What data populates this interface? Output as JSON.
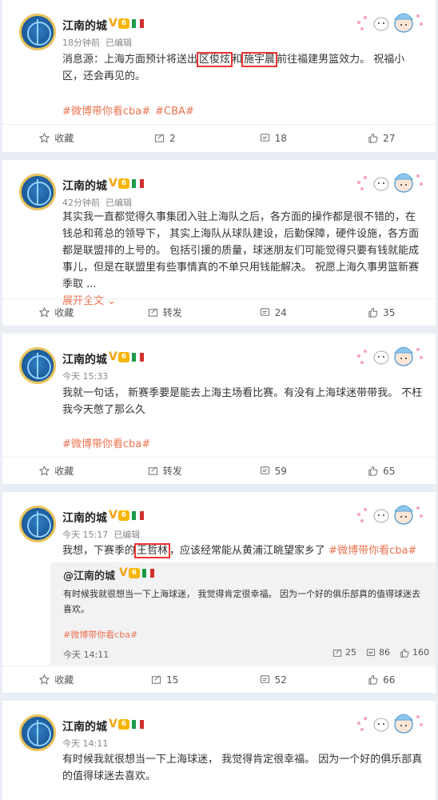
{
  "colors": {
    "accent": "#eb7350",
    "highlight": "#e33333",
    "vip": "#f5a20f"
  },
  "posts": [
    {
      "name": "江南的城",
      "time": "18分钟前",
      "edited": "已编辑",
      "text_parts": [
        "消息源：上海方面预计将送出",
        "区俊炫",
        "和",
        "施宇晨",
        "前往福建男篮效力。 祝福小区，还会再见的。"
      ],
      "tags": [
        "#微博带你看cba#",
        "#CBA#"
      ],
      "actions": {
        "fav": "收藏",
        "repost": "2",
        "comment": "18",
        "like": "27"
      }
    },
    {
      "name": "江南的城",
      "time": "42分钟前",
      "edited": "已编辑",
      "text": "其实我一直都觉得久事集团入驻上海队之后，各方面的操作都是很不错的，在钱总和蒋总的领导下， 其实上海队从球队建设，后勤保障，硬件设施，各方面都是联盟排的上号的。 包括引援的质量，球迷朋友们可能觉得只要有钱就能成事儿，但是在联盟里有些事情真的不单只用钱能解决。 祝愿上海久事男篮新赛季取 ...",
      "expand": "展开全文",
      "actions": {
        "fav": "收藏",
        "repost": "转发",
        "comment": "24",
        "like": "35"
      }
    },
    {
      "name": "江南的城",
      "time": "今天 15:33",
      "text": "我就一句话， 新赛季要是能去上海主场看比赛。有没有上海球迷带带我。 不枉我今天憋了那么久",
      "tags": [
        "#微博带你看cba#"
      ],
      "actions": {
        "fav": "收藏",
        "repost": "转发",
        "comment": "59",
        "like": "65"
      }
    },
    {
      "name": "江南的城",
      "time": "今天 15:17",
      "edited": "已编辑",
      "text_parts": [
        "我想，下赛季的",
        "王哲林",
        "，应该经常能从黄浦江眺望家乡了 "
      ],
      "inline_tag": "#微博带你看cba#",
      "quote": {
        "name": "@江南的城",
        "text": "有时候我就很想当一下上海球迷， 我觉得肯定很幸福。 因为一个好的俱乐部真的值得球迷去喜欢。",
        "tag": "#微博带你看cba#",
        "time": "今天 14:11",
        "repost": "25",
        "comment": "86",
        "like": "160"
      },
      "actions": {
        "fav": "收藏",
        "repost": "15",
        "comment": "52",
        "like": "66"
      }
    },
    {
      "name": "江南的城",
      "time": "今天 14:11",
      "text": "有时候我就很想当一下上海球迷， 我觉得肯定很幸福。 因为一个好的俱乐部真的值得球迷去喜欢。"
    }
  ]
}
